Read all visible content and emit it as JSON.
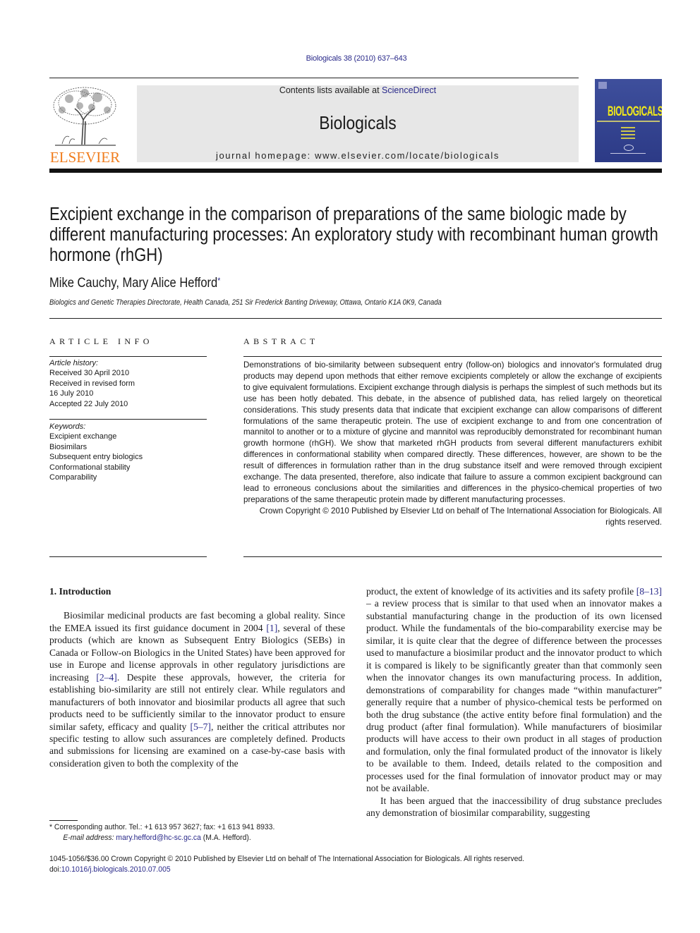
{
  "header": {
    "citation": "Biologicals 38 (2010) 637–643",
    "contents_prefix": "Contents lists available at ",
    "contents_link": "ScienceDirect",
    "journal_title": "Biologicals",
    "homepage": "journal homepage: www.elsevier.com/locate/biologicals",
    "publisher_logo_text": "ELSEVIER",
    "cover_title": "BIOLOGICALS",
    "colors": {
      "publisher_orange": "#f07d1e",
      "link_blue": "#2a2a8a",
      "cover_blue": "#3e4f9c",
      "cover_yellow": "#f3ea18"
    }
  },
  "article": {
    "title": "Excipient exchange in the comparison of preparations of the same biologic made by different manufacturing processes: An exploratory study with recombinant human growth hormone (rhGH)",
    "authors": "Mike Cauchy, Mary Alice Hefford",
    "corresponding_mark": "*",
    "affiliation": "Biologics and Genetic Therapies Directorate, Health Canada, 251 Sir Frederick Banting Driveway, Ottawa, Ontario K1A 0K9, Canada"
  },
  "article_info": {
    "heading": "ARTICLE INFO",
    "history_label": "Article history:",
    "history": [
      "Received 30 April 2010",
      "Received in revised form",
      "16 July 2010",
      "Accepted 22 July 2010"
    ],
    "keywords_label": "Keywords:",
    "keywords": [
      "Excipient exchange",
      "Biosimilars",
      "Subsequent entry biologics",
      "Conformational stability",
      "Comparability"
    ]
  },
  "abstract": {
    "heading": "ABSTRACT",
    "text": "Demonstrations of bio-similarity between subsequent entry (follow-on) biologics and innovator's formulated drug products may depend upon methods that either remove excipients completely or allow the exchange of excipients to give equivalent formulations. Excipient exchange through dialysis is perhaps the simplest of such methods but its use has been hotly debated. This debate, in the absence of published data, has relied largely on theoretical considerations. This study presents data that indicate that excipient exchange can allow comparisons of different formulations of the same therapeutic protein. The use of excipient exchange to and from one concentration of mannitol to another or to a mixture of glycine and mannitol was reproducibly demonstrated for recombinant human growth hormone (rhGH). We show that marketed rhGH products from several different manufacturers exhibit differences in conformational stability when compared directly. These differences, however, are shown to be the result of differences in formulation rather than in the drug substance itself and were removed through excipient exchange. The data presented, therefore, also indicate that failure to assure a common excipient background can lead to erroneous conclusions about the similarities and differences in the physico-chemical properties of two preparations of the same therapeutic protein made by different manufacturing processes.",
    "copyright": "Crown Copyright © 2010 Published by Elsevier Ltd on behalf of The International Association for Biologicals. All rights reserved."
  },
  "body": {
    "section_heading": "1.  Introduction",
    "left_p1_a": "Biosimilar medicinal products are fast becoming a global reality. Since the EMEA issued its first guidance document in 2004 ",
    "ref1": "[1]",
    "left_p1_b": ", several of these products (which are known as Subsequent Entry Biologics (SEBs) in Canada or Follow-on Biologics in the United States) have been approved for use in Europe and license approvals in other regulatory jurisdictions are increasing ",
    "ref2": "[2–4]",
    "left_p1_c": ". Despite these approvals, however, the criteria for establishing bio-similarity are still not entirely clear. While regulators and manufacturers of both innovator and biosimilar products all agree that such products need to be sufficiently similar to the innovator product to ensure similar safety, efficacy and quality ",
    "ref3": "[5–7]",
    "left_p1_d": ", neither the critical attributes nor specific testing to allow such assurances are completely defined. Products and submissions for licensing are examined on a case-by-case basis with consideration given to both the complexity of the",
    "right_p1_a": "product, the extent of knowledge of its activities and its safety profile ",
    "ref4": "[8–13]",
    "right_p1_b": " – a review process that is similar to that used when an innovator makes a substantial manufacturing change in the production of its own licensed product. While the fundamentals of the bio-comparability exercise may be similar, it is quite clear that the degree of difference between the processes used to manufacture a biosimilar product and the innovator product to which it is compared is likely to be significantly greater than that commonly seen when the innovator changes its own manufacturing process. In addition, demonstrations of comparability for changes made “within manufacturer” generally require that a number of physico-chemical tests be performed on both the drug substance (the active entity before final formulation) and the drug product (after final formulation). While manufacturers of biosimilar products will have access to their own product in all stages of production and formulation, only the final formulated product of the innovator is likely to be available to them. Indeed, details related to the composition and processes used for the final formulation of innovator product may or may not be available.",
    "right_p2": "It has been argued that the inaccessibility of drug substance precludes any demonstration of biosimilar comparability, suggesting"
  },
  "footnote": {
    "line1": "*  Corresponding author. Tel.: +1 613 957 3627; fax: +1 613 941 8933.",
    "email_label": "E-mail address: ",
    "email": "mary.hefford@hc-sc.gc.ca",
    "email_suffix": " (M.A. Hefford)."
  },
  "footer": {
    "issn_line": "1045-1056/$36.00 Crown Copyright © 2010 Published by Elsevier Ltd on behalf of The International Association for Biologicals. All rights reserved.",
    "doi_label": "doi:",
    "doi": "10.1016/j.biologicals.2010.07.005"
  }
}
